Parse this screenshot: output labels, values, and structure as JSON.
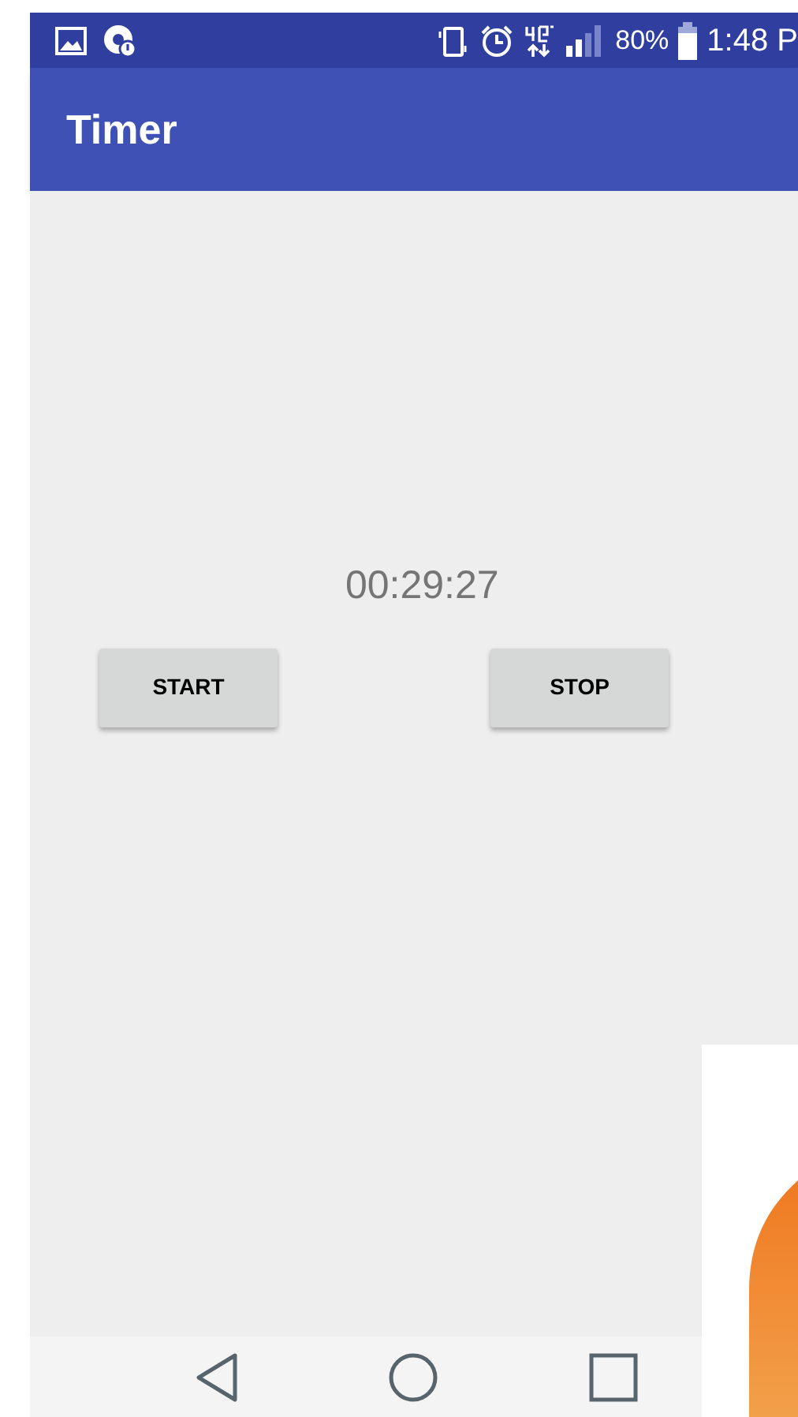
{
  "status_bar": {
    "battery": "80%",
    "time": "1:48 P"
  },
  "app_bar": {
    "title": "Timer"
  },
  "timer": {
    "display": "00:29:27"
  },
  "buttons": [
    {
      "label": "START"
    },
    {
      "label": "STOP"
    }
  ]
}
